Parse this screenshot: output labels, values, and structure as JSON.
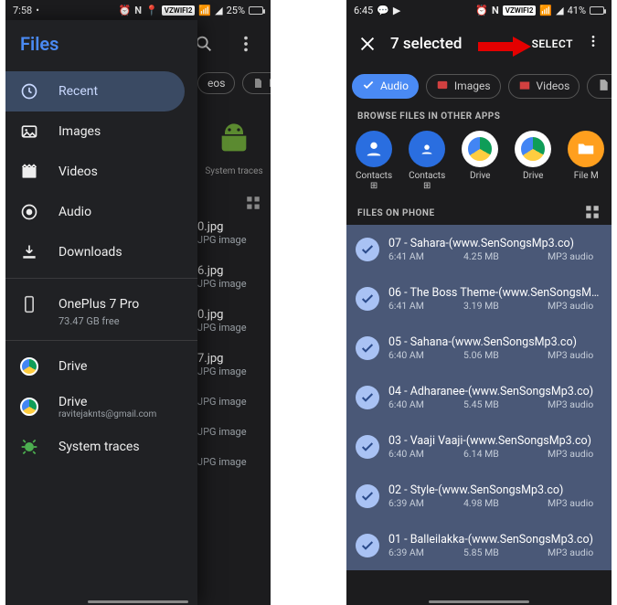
{
  "left": {
    "status": {
      "time": "7:58",
      "badge": "VZWIFI2",
      "battery_pct": "25%",
      "battery_fill": 25
    },
    "toolbar": {
      "search_icon": "search",
      "more_icon": "more"
    },
    "drawer": {
      "title": "Files",
      "nav": [
        {
          "icon": "clock",
          "label": "Recent",
          "active": true
        },
        {
          "icon": "image",
          "label": "Images"
        },
        {
          "icon": "movie",
          "label": "Videos"
        },
        {
          "icon": "audio",
          "label": "Audio"
        },
        {
          "icon": "download",
          "label": "Downloads"
        }
      ],
      "storage": {
        "icon": "phone",
        "name": "OnePlus 7 Pro",
        "free": "73.47 GB free"
      },
      "accounts": [
        {
          "icon": "drive",
          "label": "Drive",
          "sub": ""
        },
        {
          "icon": "drive",
          "label": "Drive",
          "sub": "ravitejaknts@gmail.com"
        },
        {
          "icon": "bug",
          "label": "System traces",
          "sub": ""
        }
      ]
    },
    "background": {
      "chips": [
        "eos",
        "Docume"
      ],
      "system_traces": "System traces",
      "items": [
        {
          "name": "0.jpg",
          "type": "JPG image"
        },
        {
          "name": "6.jpg",
          "type": "JPG image"
        },
        {
          "name": "0.jpg",
          "type": "JPG image"
        },
        {
          "name": "7.jpg",
          "type": "JPG image"
        },
        {
          "name": "",
          "type": "JPG image"
        },
        {
          "name": "",
          "type": "JPG image"
        },
        {
          "name": "",
          "type": "JPG image"
        }
      ]
    }
  },
  "right": {
    "status": {
      "time": "6:45",
      "badge": "VZWIFI2",
      "battery_pct": "41%",
      "battery_fill": 41
    },
    "header": {
      "close": "close",
      "title": "7 selected",
      "select": "SELECT",
      "more": "more"
    },
    "chips": [
      {
        "label": "Audio",
        "active": true,
        "icon": "check"
      },
      {
        "label": "Images",
        "active": false,
        "icon": "image",
        "color": "#d14040"
      },
      {
        "label": "Videos",
        "active": false,
        "icon": "movie",
        "color": "#d14040"
      },
      {
        "label": "Docume",
        "active": false,
        "icon": "doc",
        "color": "#aaa"
      }
    ],
    "sections": {
      "other_apps": "BROWSE FILES IN OTHER APPS",
      "files_on_phone": "FILES ON PHONE"
    },
    "apps": [
      {
        "label": "Contacts",
        "sub": "⊞",
        "bg": "#2a6ee0",
        "glyph": "person"
      },
      {
        "label": "Contacts",
        "sub": "⊞",
        "bg": "#2a6ee0",
        "glyph": "person-sq"
      },
      {
        "label": "Drive",
        "sub": "",
        "bg": "#fff",
        "glyph": "drive"
      },
      {
        "label": "Drive",
        "sub": "",
        "bg": "#fff",
        "glyph": "drive"
      },
      {
        "label": "File M",
        "sub": "",
        "bg": "#ff9f1e",
        "glyph": "folder"
      }
    ],
    "files": [
      {
        "name": "07 - Sahara-(www.SenSongsMp3.co)",
        "time": "6:41 AM",
        "size": "4.25 MB",
        "type": "MP3 audio"
      },
      {
        "name": "06 - The Boss Theme-(www.SenSongsMp3....",
        "time": "6:41 AM",
        "size": "3.19 MB",
        "type": "MP3 audio"
      },
      {
        "name": "05 - Sahana-(www.SenSongsMp3.co)",
        "time": "6:40 AM",
        "size": "5.06 MB",
        "type": "MP3 audio"
      },
      {
        "name": "04 - Adharanee-(www.SenSongsMp3.co)",
        "time": "6:40 AM",
        "size": "5.45 MB",
        "type": "MP3 audio"
      },
      {
        "name": "03 - Vaaji Vaaji-(www.SenSongsMp3.co)",
        "time": "6:40 AM",
        "size": "6.14 MB",
        "type": "MP3 audio"
      },
      {
        "name": "02 - Style-(www.SenSongsMp3.co)",
        "time": "6:39 AM",
        "size": "4.98 MB",
        "type": "MP3 audio"
      },
      {
        "name": "01 - Balleilakka-(www.SenSongsMp3.co)",
        "time": "6:39 AM",
        "size": "5.85 MB",
        "type": "MP3 audio"
      }
    ]
  }
}
